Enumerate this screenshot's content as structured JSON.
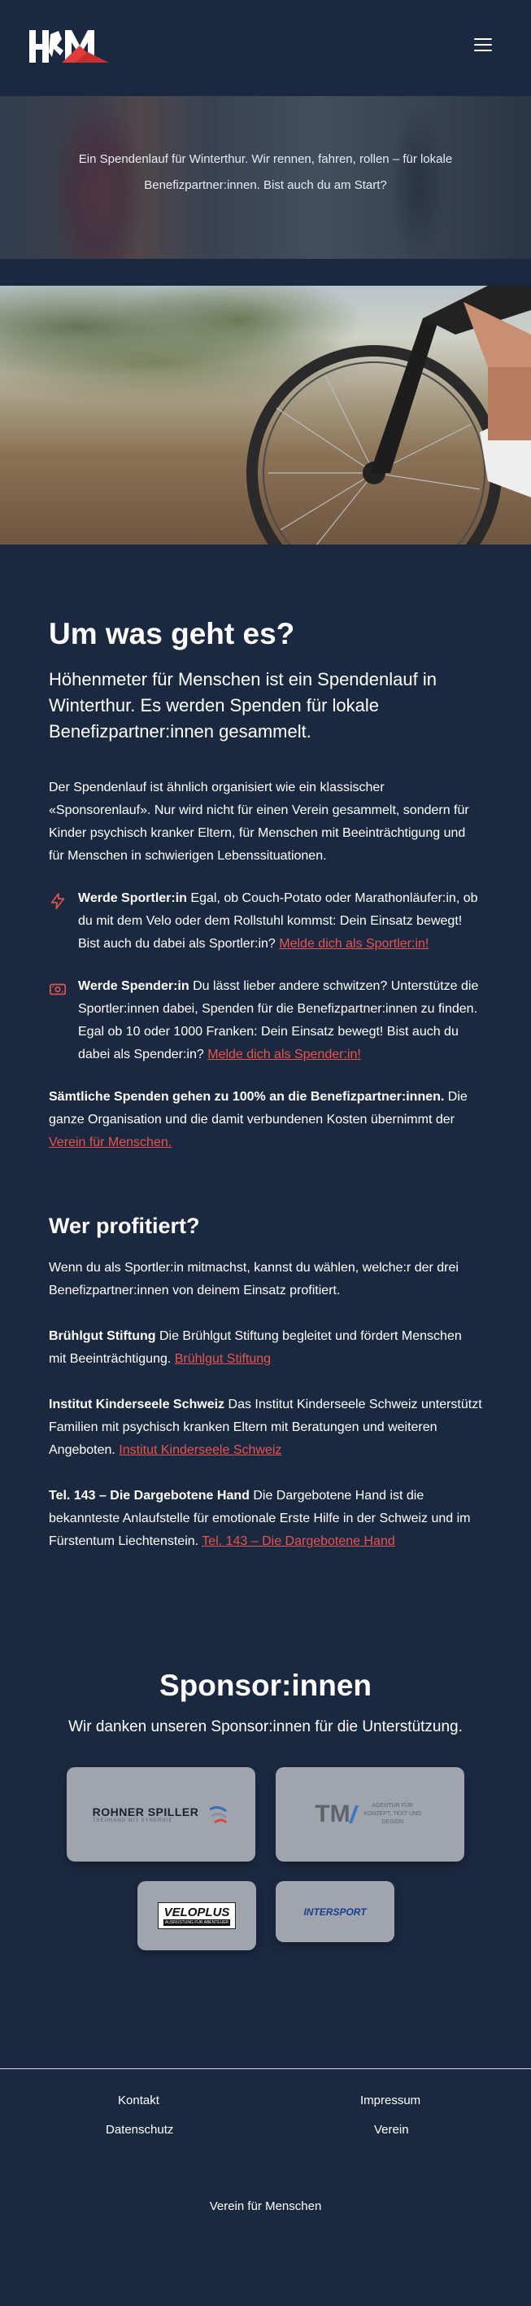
{
  "header": {
    "logo_text": "HfM",
    "menu_icon": "hamburger-menu-icon"
  },
  "hero": {
    "text": "Ein Spendenlauf für Winterthur. Wir rennen, fahren, rollen – für lokale Benefizpartner:innen. Bist auch du am Start?"
  },
  "about": {
    "title": "Um was geht es?",
    "lead": "Höhenmeter für Menschen ist ein Spendenlauf in Winterthur. Es werden Spenden für lokale Benefizpartner:innen gesammelt.",
    "intro": "Der Spendenlauf ist ähnlich organisiert wie ein klassischer «Sponsorenlauf». Nur wird nicht für einen Verein gesammelt, sondern für Kinder psychisch kranker Eltern, für Menschen mit Beeinträchtigung und für Menschen in schwierigen Lebenssituationen.",
    "sportler": {
      "icon": "lightning-icon",
      "bold": "Werde Sportler:in",
      "text": " Egal, ob Couch-Potato oder Marathonläufer:in, ob du mit dem Velo oder dem Rollstuhl kommst: Dein Einsatz bewegt! Bist auch du dabei als Sportler:in? ",
      "link": "Melde dich als Sportler:in!"
    },
    "spender": {
      "icon": "money-icon",
      "bold": "Werde Spender:in",
      "text": " Du lässt lieber andere schwitzen? Unterstütze die Sportler:innen dabei, Spenden für die Benefizpartner:innen zu finden. Egal ob 10 oder 1000 Franken: Dein Einsatz bewegt! Bist auch du dabei als Spender:in? ",
      "link": "Melde dich als Spender:in!"
    },
    "donation": {
      "bold": "Sämtliche Spenden gehen zu 100% an die Benefizpartner:innen.",
      "text": " Die ganze Organisation und die damit verbundenen Kosten übernimmt der ",
      "link": "Verein für Menschen."
    }
  },
  "beneficiaries": {
    "title": "Wer profitiert?",
    "intro": "Wenn du als Sportler:in mitmachst, kannst du wählen, welche:r der drei Benefizpartner:innen von deinem Einsatz profitiert.",
    "items": [
      {
        "name": "Brühlgut Stiftung",
        "text": " Die Brühlgut Stiftung begleitet und fördert Menschen mit Beeinträchtigung. ",
        "link": "Brühlgut Stiftung"
      },
      {
        "name": "Institut Kinderseele Schweiz",
        "text": " Das Institut Kinderseele Schweiz unterstützt Familien mit psychisch kranken Eltern mit Beratungen und weiteren Angeboten. ",
        "link": "Institut Kinderseele Schweiz"
      },
      {
        "name": "Tel. 143 – Die Dargebotene Hand",
        "text": " Die Dargebotene Hand ist die bekannteste Anlaufstelle für emotionale Erste Hilfe in der Schweiz und im Fürstentum Liechtenstein. ",
        "link": "Tel. 143 – Die Dargebotene Hand"
      }
    ]
  },
  "sponsors": {
    "title": "Sponsor:innen",
    "subtitle": "Wir danken unseren Sponsor:innen für die Unterstützung.",
    "logos": [
      {
        "name": "ROHNER SPILLER",
        "tagline": "TREUHAND MIT SYNERGIE"
      },
      {
        "name": "TM",
        "tagline": "AGENTUR FÜR KONZEPT, TEXT UND DESIGN"
      },
      {
        "name": "VELOPLUS",
        "tagline": "AUSRÜSTUNG FÜR ABENTEUER"
      },
      {
        "name": "INTERSPORT",
        "tagline": ""
      }
    ]
  },
  "footer": {
    "kontakt": "Kontakt",
    "impressum": "Impressum",
    "datenschutz": "Datenschutz",
    "verein": "Verein",
    "org": "Verein für Menschen"
  },
  "colors": {
    "background": "#1b2940",
    "accent": "#e8534f",
    "card": "#a0a4ac"
  }
}
